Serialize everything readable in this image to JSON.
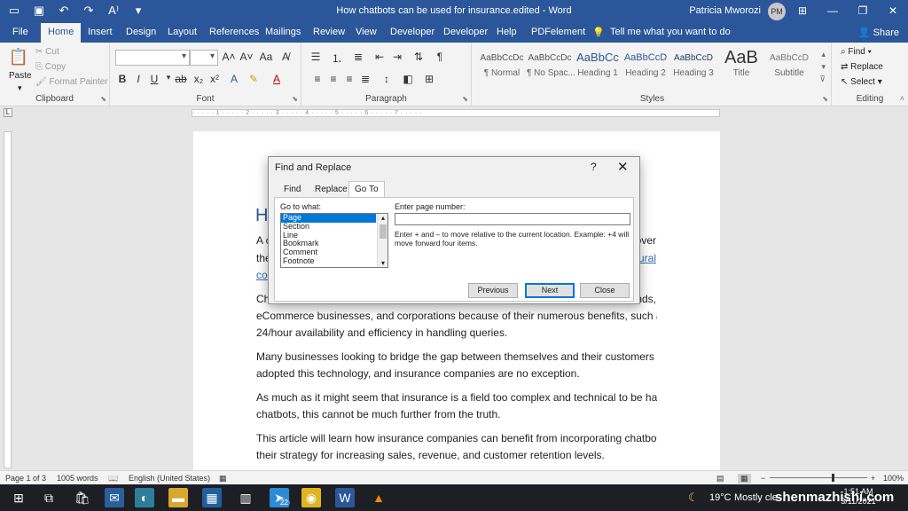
{
  "titlebar": {
    "title": "How chatbots can be used for insurance.edited - Word",
    "user": "Patricia Mworozi",
    "initials": "PM"
  },
  "tabs": [
    "File",
    "Home",
    "Insert",
    "Design",
    "Layout",
    "References",
    "Mailings",
    "Review",
    "View",
    "Developer",
    "Developer",
    "Help",
    "PDFelement"
  ],
  "tell_me": "Tell me what you want to do",
  "share": "Share",
  "ribbon": {
    "clipboard": {
      "paste": "Paste",
      "cut": "Cut",
      "copy": "Copy",
      "format_painter": "Format Painter",
      "label": "Clipboard"
    },
    "font": {
      "label": "Font"
    },
    "paragraph": {
      "label": "Paragraph"
    },
    "styles": {
      "label": "Styles",
      "items": [
        {
          "sample": "AaBbCcDc",
          "name": "¶ Normal"
        },
        {
          "sample": "AaBbCcDc",
          "name": "¶ No Spac..."
        },
        {
          "sample": "AaBbCc",
          "name": "Heading 1"
        },
        {
          "sample": "AaBbCcD",
          "name": "Heading 2"
        },
        {
          "sample": "AaBbCcD",
          "name": "Heading 3"
        },
        {
          "sample": "AaB",
          "name": "Title"
        },
        {
          "sample": "AaBbCcD",
          "name": "Subtitle"
        }
      ]
    },
    "editing": {
      "find": "Find",
      "replace": "Replace",
      "select": "Select",
      "label": "Editing"
    }
  },
  "document": {
    "heading_fragment": "H",
    "lines": [
      {
        "start": "A c",
        "end": "over"
      },
      {
        "start": "the",
        "end": "tural",
        "end_link": true
      },
      {
        "start": "co",
        "start_link": true,
        "end": ""
      },
      {
        "start": "Ch",
        "end": "nds,"
      }
    ],
    "paragraphs": [
      "eCommerce businesses, and corporations because of their numerous benefits, such as",
      "24/hour availability and efficiency in handling queries.",
      "Many businesses looking to bridge the gap between themselves and their customers have",
      "adopted this technology, and insurance companies are no exception.",
      "As much as it might seem that insurance is a field too complex and technical to be handled by",
      "chatbots, this cannot be much further from the truth.",
      "This article will learn how insurance companies can benefit from incorporating chatbots into",
      "their strategy for increasing sales, revenue, and customer retention levels."
    ]
  },
  "dialog": {
    "title": "Find and Replace",
    "help": "?",
    "close": "✕",
    "tabs": [
      "Find",
      "Replace",
      "Go To"
    ],
    "goto_label": "Go to what:",
    "goto_options": [
      "Page",
      "Section",
      "Line",
      "Bookmark",
      "Comment",
      "Footnote"
    ],
    "selected_option": "Page",
    "page_number_label": "Enter page number:",
    "page_number_value": "",
    "hint": "Enter + and – to move relative to the current location. Example: +4 will move forward four items.",
    "buttons": {
      "previous": "Previous",
      "next": "Next",
      "close": "Close"
    }
  },
  "statusbar": {
    "page": "Page 1 of 3",
    "words": "1005 words",
    "language": "English (United States)",
    "zoom": "100%"
  },
  "taskbar": {
    "weather": "19°C",
    "condition": "Mostly cle",
    "time": "1:51 AM",
    "date": "3/11/2021",
    "badge": "22",
    "watermark": "shenmazhishi.com"
  },
  "colors": {
    "word_blue": "#2b579a",
    "taskbar": "#1d1f24",
    "selection": "#0078d7"
  }
}
